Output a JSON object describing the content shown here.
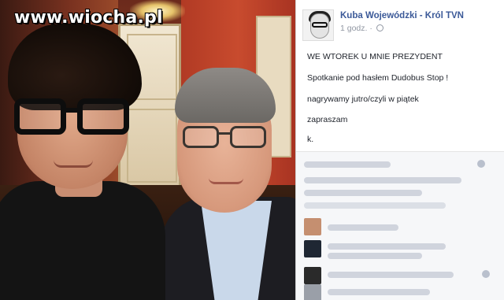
{
  "watermark": {
    "text": "www.wiocha.pl"
  },
  "post": {
    "author": "Kuba Wojewódzki - Król TVN",
    "time": "1 godz.",
    "separator": "·",
    "lines": [
      "WE WTOREK U MNIE PREZYDENT",
      "Spotkanie pod hasłem Dudobus Stop !",
      "nagrywamy jutro/czyli w piątek",
      "zapraszam",
      "k."
    ]
  },
  "icons": {
    "avatar": "profile-avatar",
    "audience": "globe-icon"
  },
  "colors": {
    "author_link": "#3b5998",
    "meta_text": "#9197a3",
    "comment_bg": "#f6f7f9"
  }
}
